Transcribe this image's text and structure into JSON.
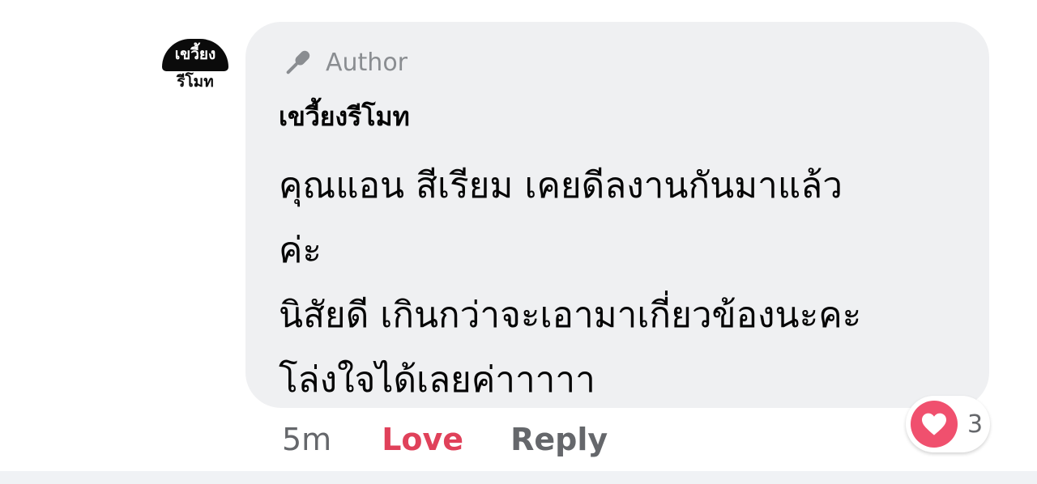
{
  "comment": {
    "avatar": {
      "line1": "เขวี้ยง",
      "line2": "รีโมท"
    },
    "badge": {
      "icon": "microphone-icon",
      "label": "Author"
    },
    "author_name": "เขวี้ยงรีโมท",
    "message_lines": [
      "คุณแอน สีเรียม เคยดีลงานกันมาแล้ว",
      "ค่ะ",
      "นิสัยดี เกินกว่าจะเอามาเกี่ยวข้องนะคะ",
      "โล่งใจได้เลยค่าาาาา"
    ],
    "time": "5m",
    "love_label": "Love",
    "reply_label": "Reply",
    "reaction": {
      "icon": "heart-icon",
      "count": "3"
    }
  },
  "colors": {
    "bubble": "#eff0f2",
    "love": "#e0415a",
    "secondary_text": "#65676b",
    "heart": "#f0506e"
  }
}
